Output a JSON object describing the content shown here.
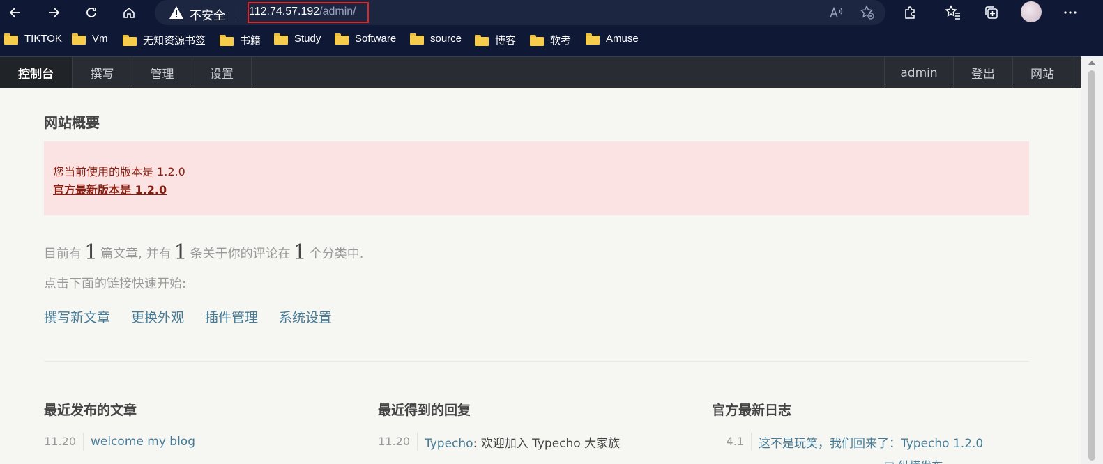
{
  "browser": {
    "security_label": "不安全",
    "url_host": "112.74.57.192",
    "url_path": "/admin/",
    "bookmarks": [
      {
        "label": "TIKTOK"
      },
      {
        "label": "Vm"
      },
      {
        "label": "无知资源书签"
      },
      {
        "label": "书籍"
      },
      {
        "label": "Study"
      },
      {
        "label": "Software"
      },
      {
        "label": "source"
      },
      {
        "label": "博客"
      },
      {
        "label": "软考"
      },
      {
        "label": "Amuse"
      }
    ]
  },
  "nav": {
    "left": [
      {
        "label": "控制台"
      },
      {
        "label": "撰写"
      },
      {
        "label": "管理"
      },
      {
        "label": "设置"
      }
    ],
    "right": [
      {
        "label": "admin"
      },
      {
        "label": "登出"
      },
      {
        "label": "网站"
      }
    ]
  },
  "overview": {
    "title": "网站概要",
    "version_current": "您当前使用的版本是 1.2.0",
    "version_latest": "官方最新版本是 1.2.0",
    "stats": {
      "prefix": "目前有",
      "posts": "1",
      "posts_unit": "篇文章, 并有",
      "comments": "1",
      "comments_unit": "条关于你的评论在",
      "categories": "1",
      "categories_unit": "个分类中."
    },
    "quick_hint": "点击下面的链接快速开始:",
    "quick_links": [
      "撰写新文章",
      "更换外观",
      "插件管理",
      "系统设置"
    ]
  },
  "columns": {
    "recent_posts": {
      "title": "最近发布的文章",
      "items": [
        {
          "date": "11.20",
          "text": "welcome my blog"
        }
      ]
    },
    "recent_replies": {
      "title": "最近得到的回复",
      "items": [
        {
          "date": "11.20",
          "author": "Typecho",
          "text": ": 欢迎加入 Typecho 大家族"
        }
      ]
    },
    "official_log": {
      "title": "官方最新日志",
      "items": [
        {
          "date": "4.1",
          "text": "这不是玩笑，我们回来了：Typecho 1.2.0"
        }
      ],
      "partial_next": "□ 纵横发布"
    }
  }
}
